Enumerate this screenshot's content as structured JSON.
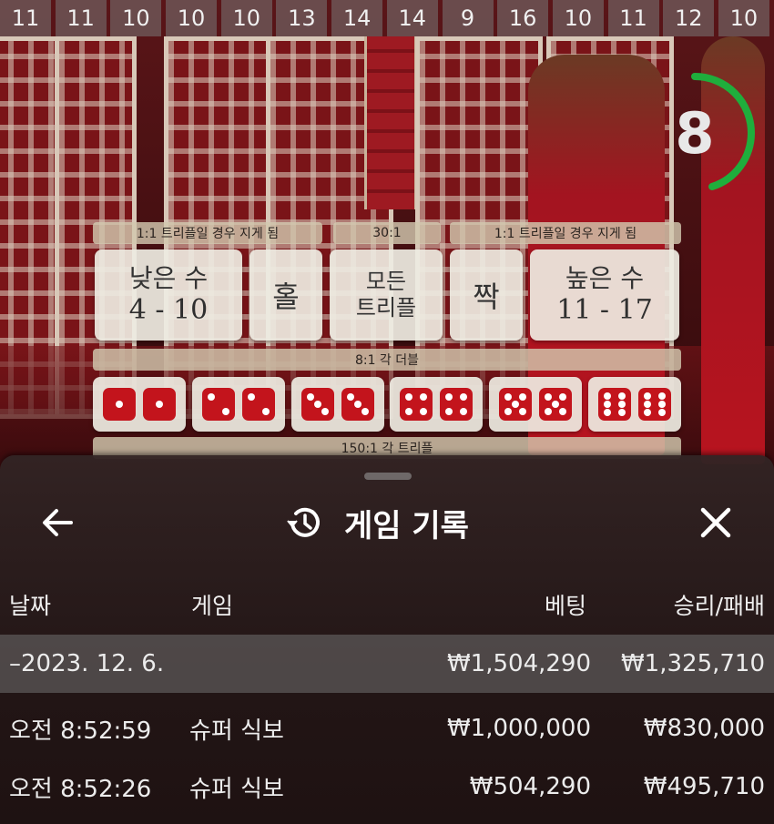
{
  "history_numbers": [
    "11",
    "11",
    "10",
    "10",
    "10",
    "13",
    "14",
    "14",
    "9",
    "16",
    "10",
    "11",
    "12",
    "10"
  ],
  "timer": {
    "value": "8",
    "ring_color": "#1fae3c",
    "fraction": 0.45
  },
  "board": {
    "payout_left": "1:1 트리플일 경우 지게 됨",
    "payout_mid": "30:1",
    "payout_right": "1:1 트리플일 경우 지게 됨",
    "payout_doubles": "8:1 각 더블",
    "payout_triples": "150:1 각 트리플",
    "low_title": "낮은 수",
    "low_range": "4 - 10",
    "odd": "홀",
    "any_triple_1": "모든",
    "any_triple_2": "트리플",
    "even": "짝",
    "high_title": "높은 수",
    "high_range": "11 - 17",
    "doubles": [
      1,
      2,
      3,
      4,
      5,
      6
    ],
    "die_color": "#c3141c"
  },
  "panel": {
    "back_icon": "arrow-left-icon",
    "history_icon": "history-icon",
    "title": "게임 기록",
    "close_icon": "close-icon",
    "columns": {
      "date": "날짜",
      "game": "게임",
      "bet": "베팅",
      "winloss": "승리/패배"
    },
    "summary": {
      "date": "–2023. 12. 6.",
      "bet": "₩1,504,290",
      "winloss": "₩1,325,710"
    },
    "rows": [
      {
        "time": "오전 8:52:59",
        "game": "슈퍼 식보",
        "bet": "₩1,000,000",
        "winloss": "₩830,000"
      },
      {
        "time": "오전 8:52:26",
        "game": "슈퍼 식보",
        "bet": "₩504,290",
        "winloss": "₩495,710"
      }
    ]
  }
}
